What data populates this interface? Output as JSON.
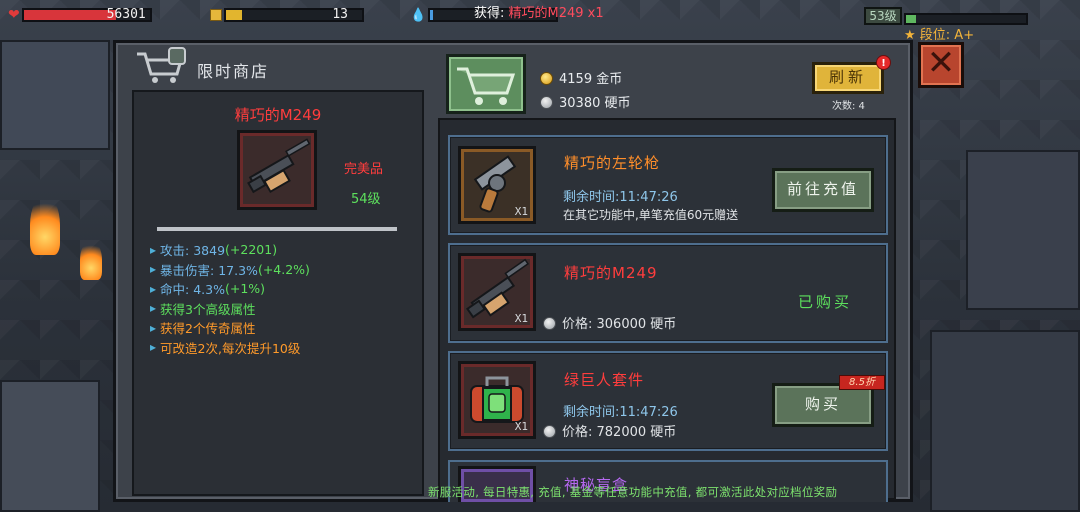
{
  "hud": {
    "hp_value": "56301",
    "hp_fill": 0.73,
    "energy_value": "13",
    "energy_fill": 0.12,
    "mana_fill": 0.02,
    "level_badge": "53级",
    "rank": "段位: A+"
  },
  "top_message": {
    "prefix": "获得: ",
    "item": "精巧的M249 x1"
  },
  "shop": {
    "title": "限时商店",
    "close": "✕",
    "currencies": [
      {
        "value": "4159",
        "unit": "金币",
        "icon": "gold-coin-icon"
      },
      {
        "value": "30380",
        "unit": "硬币",
        "icon": "silver-coin-icon"
      }
    ],
    "refresh_label": "刷新",
    "notification": "!",
    "refresh_count": "次数: 4"
  },
  "detail": {
    "name": "精巧的M249",
    "quality": "完美品",
    "level": "54级",
    "stats": [
      {
        "label": "攻击: 3849 ",
        "bonus": "(+2201)"
      },
      {
        "label": "暴击伤害: 17.3% ",
        "bonus": "(+4.2%)"
      },
      {
        "label": "命中: 4.3% ",
        "bonus": "(+1%)"
      },
      {
        "label": "获得3个高级属性",
        "bonus": ""
      },
      {
        "label": "获得2个传奇属性",
        "bonus": ""
      },
      {
        "label": "可改造2次,每次提升10级",
        "bonus": ""
      }
    ]
  },
  "listings": [
    {
      "title": "精巧的左轮枪",
      "quantity": "X1",
      "timer": "剩余时间:11:47:26",
      "note": "在其它功能中,单笔充值60元赠送",
      "button": "前往充值",
      "icon": "revolver-icon"
    },
    {
      "title": "精巧的M249",
      "quantity": "X1",
      "price_label": "价格: 306000 硬币",
      "status": "已购买",
      "icon": "m249-gun-icon"
    },
    {
      "title": "绿巨人套件",
      "quantity": "X1",
      "timer": "剩余时间:11:47:26",
      "price_label": "价格: 782000 硬币",
      "button": "购买",
      "discount": "8.5折",
      "icon": "hulk-kit-icon"
    }
  ],
  "partial_listing": {
    "title": "神秘盲盒"
  },
  "ticker": "新服活动, 每日特惠, 充值, 基金等任意功能中充值, 都可激活此处对应档位奖励",
  "colors": {
    "panel": "#3d424a",
    "refresh": "#e0b43a",
    "close": "#b8452e",
    "legendary_red": "#ff3d3d",
    "epic_orange": "#ff8e2a",
    "stat_green": "#5de05d",
    "button_green": "#5b735a"
  }
}
